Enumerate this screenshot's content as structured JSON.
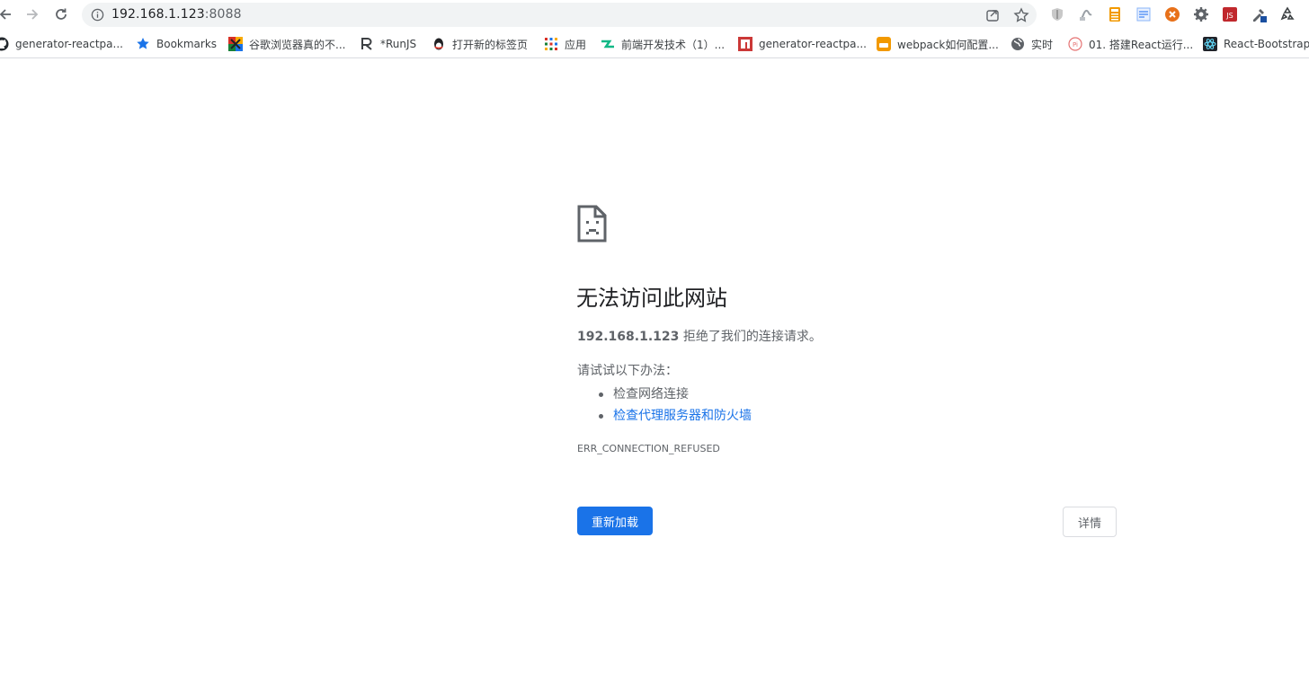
{
  "omnibox": {
    "host": "192.168.1.123",
    "port": ":8088"
  },
  "bookmarks": [
    {
      "label": "generator-reactpa...",
      "icon": "github-icon"
    },
    {
      "label": "Bookmarks",
      "icon": "star-icon"
    },
    {
      "label": "谷歌浏览器真的不...",
      "icon": "colorful-logo-icon"
    },
    {
      "label": "*RunJS",
      "icon": "runjs-icon"
    },
    {
      "label": "打开新的标签页",
      "icon": "qq-penguin-icon"
    },
    {
      "label": "应用",
      "icon": "apps-grid-icon"
    },
    {
      "label": "前端开发技术（1）...",
      "icon": "teal-logo-icon"
    },
    {
      "label": "generator-reactpa...",
      "icon": "red-n-icon"
    },
    {
      "label": "webpack如何配置...",
      "icon": "orange-logo-icon"
    },
    {
      "label": "实时",
      "icon": "globe-icon"
    },
    {
      "label": "01. 搭建React运行...",
      "icon": "pink-logo-icon"
    },
    {
      "label": "React-Bootstrap",
      "icon": "react-bootstrap-icon"
    }
  ],
  "error": {
    "title": "无法访问此网站",
    "host": "192.168.1.123",
    "summary_rest": " 拒绝了我们的连接请求。",
    "suggest_head": "请试试以下办法：",
    "suggestions": [
      "检查网络连接",
      "检查代理服务器和防火墙"
    ],
    "code": "ERR_CONNECTION_REFUSED"
  },
  "buttons": {
    "reload": "重新加载",
    "details": "详情"
  },
  "colors": {
    "accent": "#1a73e8",
    "text_secondary": "#5f6368"
  }
}
